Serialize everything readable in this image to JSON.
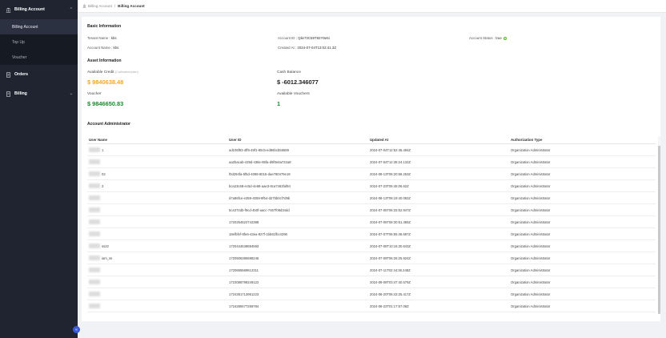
{
  "sidebar": {
    "billing_account": {
      "label": "Billing Account",
      "icon": "bank-icon"
    },
    "sub_items": [
      {
        "label": "Billing Account",
        "active": true
      },
      {
        "label": "Top Up",
        "active": false
      },
      {
        "label": "Voucher",
        "active": false
      }
    ],
    "orders": {
      "label": "Orders",
      "icon": "document-icon"
    },
    "billing": {
      "label": "Billing",
      "icon": "receipt-icon"
    },
    "collapse_glyph": "«"
  },
  "breadcrumb": {
    "root": "Billing Account",
    "separator": "/",
    "current": "Billing Account"
  },
  "basic_info": {
    "title": "Basic Information",
    "tenant_name_label": "Tenant Name :",
    "tenant_name": "kbs",
    "account_name_label": "Account Name :",
    "account_name": "kbs",
    "account_id_label": "Account ID :",
    "account_id": "Qile73C59T82Y9e5i",
    "created_at_label": "Created At :",
    "created_at": "2024-07-04T13:02:41.3Z",
    "status_label": "Account Status :",
    "status": "true"
  },
  "asset_info": {
    "title": "Asset Information",
    "available_credit_label": "Available Credit",
    "available_credit_hint": "(Calibration/plan)",
    "available_credit": "$ 9840638.48",
    "cash_balance_label": "Cash Balance",
    "cash_balance": "$ -6012.346077",
    "voucher_label": "Voucher",
    "voucher": "$ 9846650.83",
    "available_vouchers_label": "Available Vouchers",
    "available_vouchers": "1"
  },
  "admins": {
    "title": "Account Administrator",
    "columns": [
      "User Name",
      "User ID",
      "Updated At",
      "Authorization Type"
    ],
    "rows": [
      {
        "name": "1",
        "id": "ad106f93-4ff6-49f1-80cb-ed86bcb55589",
        "updated": "2024-07-04T12:52:45.494Z",
        "auth": "Organization Administrator"
      },
      {
        "name": "",
        "id": "aa2bacab-439d-438e-85fa-d9f0e8a722a8",
        "updated": "2024-07-04T12:38:24.132Z",
        "auth": "Organization Administrator"
      },
      {
        "name": "02",
        "id": "f0d294fa-5f5d-4098-8015-dae780479e19",
        "updated": "2024-08-13T06:20:58.253Z",
        "auth": "Organization Administrator"
      },
      {
        "name": "3",
        "id": "bca23c68-ec5d-4e68-aae3-8ca7462faf94",
        "updated": "2024-07-23T05:45:06.62Z",
        "auth": "Organization Administrator"
      },
      {
        "name": "",
        "id": "d7a86fce-e359-4059-9f54-d27bb0cf7d9b",
        "updated": "2024-08-13T06:19:40.082Z",
        "auth": "Organization Administrator"
      },
      {
        "name": "",
        "id": "5c4272db-f9cd-450f-aacc-7467f08d34dd",
        "updated": "2024-07-05T06:33:52.947Z",
        "auth": "Organization Administrator"
      },
      {
        "name": "",
        "id": "1720254622742388",
        "updated": "2024-07-06T08:30:51.365Z",
        "auth": "Organization Administrator"
      },
      {
        "name": "",
        "id": "18efbfef-8fe6-43ea-827f-1bb61fbc4296",
        "updated": "2024-07-07T06:55:46.697Z",
        "auth": "Organization Administrator"
      },
      {
        "name": "ss22",
        "id": "1720444538694593",
        "updated": "2024-07-08T10:16:30.643Z",
        "auth": "Organization Administrator"
      },
      {
        "name": "iam_ss",
        "id": "1720506385698246",
        "updated": "2024-07-09T06:26:25.924Z",
        "auth": "Organization Administrator"
      },
      {
        "name": "",
        "id": "1720665569612311",
        "updated": "2024-07-11T02:44:36.248Z",
        "auth": "Organization Administrator"
      },
      {
        "name": "",
        "id": "1723088798249122",
        "updated": "2024-08-08T03:47:40.579Z",
        "auth": "Organization Administrator"
      },
      {
        "name": "",
        "id": "1724361713951223",
        "updated": "2024-08-20T06:43:25.417Z",
        "auth": "Organization Administrator"
      },
      {
        "name": "",
        "id": "1724289477259784",
        "updated": "2024-08-22T01:17:57.08Z",
        "auth": "Organization Administrator"
      }
    ]
  },
  "colors": {
    "credit": "#f5a623",
    "cash_balance": "#222222",
    "voucher": "#1a8a2e",
    "available_vouchers": "#1a8a2e",
    "status_ok": "#52c41a"
  }
}
